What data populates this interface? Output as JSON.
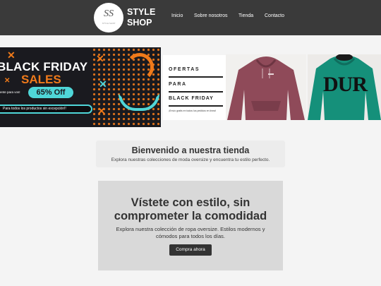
{
  "header": {
    "logo_monogram": "SS",
    "logo_tagline": "STYLE SHOP",
    "brand_line1": "STYLE",
    "brand_line2": "SHOP",
    "nav": [
      {
        "label": "Inicio"
      },
      {
        "label": "Sobre nosotros"
      },
      {
        "label": "Tienda"
      },
      {
        "label": "Contacto"
      }
    ]
  },
  "banners": {
    "black_friday": {
      "title": "BLACK FRIDAY",
      "subtitle": "SALES",
      "small_text": "ente para vos!",
      "discount": "65% Off",
      "strip_text": "Para todos  los productos sin excepción!!"
    },
    "ofertas": {
      "line1": "OFERTAS",
      "line2": "PARA",
      "line3": "BLACK FRIDAY",
      "tiny": "¡Envío gratis en todos los pedidos en línea!"
    },
    "hoodie_print": "DUR"
  },
  "welcome": {
    "title": "Bienvenido a nuestra tienda",
    "subtitle": "Explora nuestras colecciones de moda oversize y encuentra tu estilo perfecto."
  },
  "hero": {
    "title": "Vístete con estilo, sin comprometer la comodidad",
    "text": "Explora nuestra colección de ropa oversize. Estilos modernos y cómodos para todos los días.",
    "button_label": "Compra ahora"
  },
  "colors": {
    "header_bg": "#3a3a3a",
    "accent_orange": "#f07a1a",
    "accent_cyan": "#4fd6d8",
    "hoodie_maroon": "#8f4a59",
    "hoodie_green": "#15907a",
    "button_bg": "#333333"
  }
}
